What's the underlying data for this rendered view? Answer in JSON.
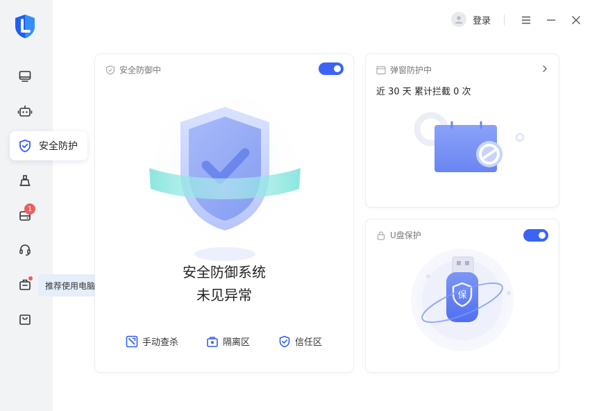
{
  "sidebar": {
    "active_label": "安全防护",
    "badge_count": "1",
    "tip_text": "推荐使用电脑异常修复"
  },
  "header": {
    "login_label": "登录"
  },
  "defense_card": {
    "title": "安全防御中",
    "toggle_on": true,
    "status_line1": "安全防御系统",
    "status_line2": "未见异常",
    "actions": [
      "手动查杀",
      "隔离区",
      "信任区"
    ]
  },
  "popup_card": {
    "title": "弹窗防护中",
    "stat": "近 30 天 累计拦截 0 次"
  },
  "usb_card": {
    "title": "U盘保护",
    "toggle_on": true,
    "usb_glyph": "保"
  },
  "colors": {
    "accent": "#3b64f5",
    "badge": "#f25c5c"
  }
}
